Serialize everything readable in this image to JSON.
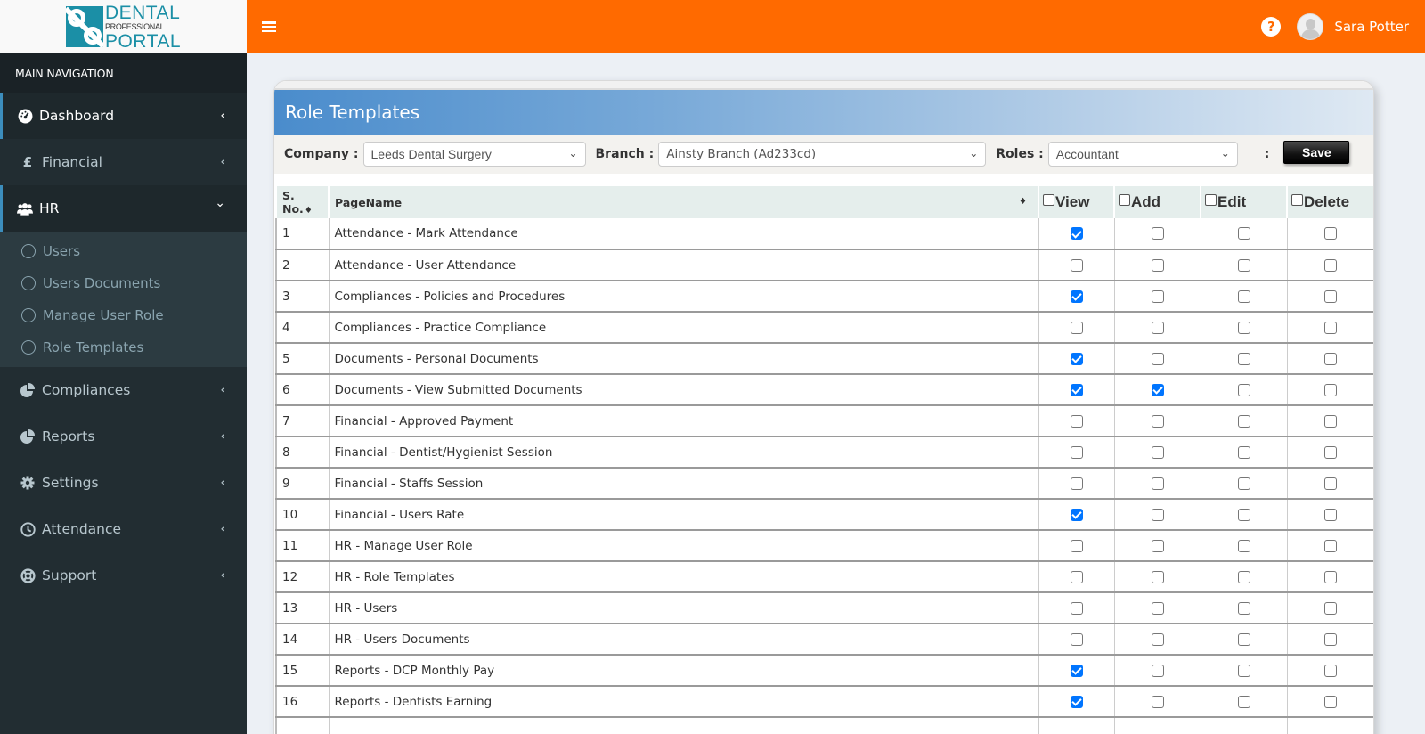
{
  "brand": {
    "logo_line1": "DENTAL",
    "logo_line2": "PROFESSIONAL",
    "logo_line3": "PORTAL",
    "accent_color": "#ff6a00",
    "sidebar_color": "#222d32"
  },
  "topbar": {
    "help_icon": "question-circle-icon",
    "user_name": "Sara Potter"
  },
  "sidebar": {
    "header": "MAIN NAVIGATION",
    "items": [
      {
        "label": "Dashboard",
        "icon": "dashboard-icon",
        "chevron": "‹"
      },
      {
        "label": "Financial",
        "icon": "pound-icon",
        "chevron": "‹"
      },
      {
        "label": "HR",
        "icon": "users-icon",
        "chevron": "⌄",
        "children": [
          "Users",
          "Users Documents",
          "Manage User Role",
          "Role Templates"
        ]
      },
      {
        "label": "Compliances",
        "icon": "pie-chart-icon",
        "chevron": "‹"
      },
      {
        "label": "Reports",
        "icon": "pie-chart-icon",
        "chevron": "‹"
      },
      {
        "label": "Settings",
        "icon": "gear-icon",
        "chevron": "‹"
      },
      {
        "label": "Attendance",
        "icon": "clock-icon",
        "chevron": "‹"
      },
      {
        "label": "Support",
        "icon": "life-ring-icon",
        "chevron": "‹"
      }
    ]
  },
  "page": {
    "title": "Role Templates",
    "filters": {
      "company_label": "Company :",
      "company_value": "Leeds Dental Surgery",
      "branch_label": "Branch :",
      "branch_value": "Ainsty Branch (Ad233cd)",
      "roles_label": "Roles :",
      "roles_value": "Accountant",
      "separator": ":",
      "save_label": "Save"
    },
    "table": {
      "columns": {
        "sno": "S. No.",
        "page_name": "PageName",
        "view": "View",
        "add": "Add",
        "edit": "Edit",
        "delete": "Delete"
      },
      "rows": [
        {
          "sno": "1",
          "page": "Attendance - Mark Attendance",
          "view": true,
          "add": false,
          "edit": false,
          "delete": false
        },
        {
          "sno": "2",
          "page": "Attendance - User Attendance",
          "view": false,
          "add": false,
          "edit": false,
          "delete": false
        },
        {
          "sno": "3",
          "page": "Compliances - Policies and Procedures",
          "view": true,
          "add": false,
          "edit": false,
          "delete": false
        },
        {
          "sno": "4",
          "page": "Compliances - Practice Compliance",
          "view": false,
          "add": false,
          "edit": false,
          "delete": false
        },
        {
          "sno": "5",
          "page": "Documents - Personal Documents",
          "view": true,
          "add": false,
          "edit": false,
          "delete": false
        },
        {
          "sno": "6",
          "page": "Documents - View Submitted Documents",
          "view": true,
          "add": true,
          "edit": false,
          "delete": false
        },
        {
          "sno": "7",
          "page": "Financial - Approved Payment",
          "view": false,
          "add": false,
          "edit": false,
          "delete": false
        },
        {
          "sno": "8",
          "page": "Financial - Dentist/Hygienist Session",
          "view": false,
          "add": false,
          "edit": false,
          "delete": false
        },
        {
          "sno": "9",
          "page": "Financial - Staffs Session",
          "view": false,
          "add": false,
          "edit": false,
          "delete": false
        },
        {
          "sno": "10",
          "page": "Financial - Users Rate",
          "view": true,
          "add": false,
          "edit": false,
          "delete": false
        },
        {
          "sno": "11",
          "page": "HR - Manage User Role",
          "view": false,
          "add": false,
          "edit": false,
          "delete": false
        },
        {
          "sno": "12",
          "page": "HR - Role Templates",
          "view": false,
          "add": false,
          "edit": false,
          "delete": false
        },
        {
          "sno": "13",
          "page": "HR - Users",
          "view": false,
          "add": false,
          "edit": false,
          "delete": false
        },
        {
          "sno": "14",
          "page": "HR - Users Documents",
          "view": false,
          "add": false,
          "edit": false,
          "delete": false
        },
        {
          "sno": "15",
          "page": "Reports - DCP Monthly Pay",
          "view": true,
          "add": false,
          "edit": false,
          "delete": false
        },
        {
          "sno": "16",
          "page": "Reports - Dentists Earning",
          "view": true,
          "add": false,
          "edit": false,
          "delete": false
        },
        {
          "sno": "",
          "page": "",
          "view": false,
          "add": false,
          "edit": false,
          "delete": false
        }
      ]
    }
  }
}
